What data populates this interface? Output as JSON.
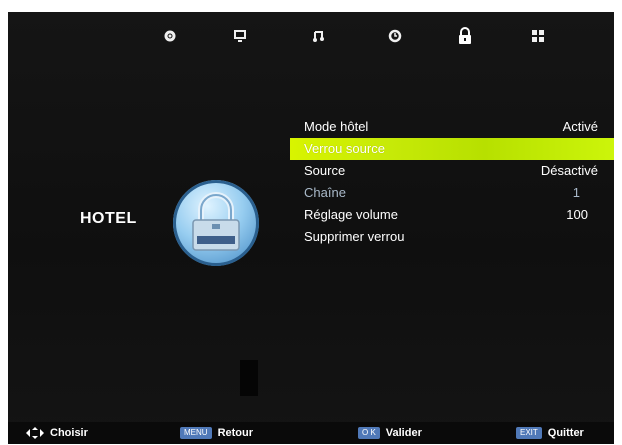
{
  "top_tabs": [
    {
      "name": "settings",
      "icon": "gear-icon",
      "active": false
    },
    {
      "name": "screen",
      "icon": "monitor-icon",
      "active": false
    },
    {
      "name": "audio",
      "icon": "music-note-icon",
      "active": false
    },
    {
      "name": "time",
      "icon": "clock-icon",
      "active": false
    },
    {
      "name": "lock",
      "icon": "padlock-icon",
      "active": true
    },
    {
      "name": "apps",
      "icon": "grid-icon",
      "active": false
    }
  ],
  "section_label": "HOTEL",
  "menu": {
    "items": [
      {
        "label": "Mode hôtel",
        "value": "Activé",
        "state": "normal"
      },
      {
        "label": "Verrou source",
        "value": "",
        "state": "selected"
      },
      {
        "label": "Source",
        "value": "Désactivé",
        "state": "normal"
      },
      {
        "label": "Chaîne",
        "value": "1",
        "state": "dim"
      },
      {
        "label": "Réglage volume",
        "value": "100",
        "state": "normal"
      },
      {
        "label": "Supprimer verrou",
        "value": "",
        "state": "normal"
      }
    ]
  },
  "footer": {
    "choose": {
      "label": "Choisir",
      "icon": "dpad-icon"
    },
    "back": {
      "key": "MENU",
      "label": "Retour"
    },
    "ok": {
      "key": "O K",
      "label": "Valider"
    },
    "exit": {
      "key": "EXIT",
      "label": "Quitter"
    }
  },
  "colors": {
    "highlight": "#c7ea08",
    "panel": "#121212",
    "key": "#5079b8"
  }
}
